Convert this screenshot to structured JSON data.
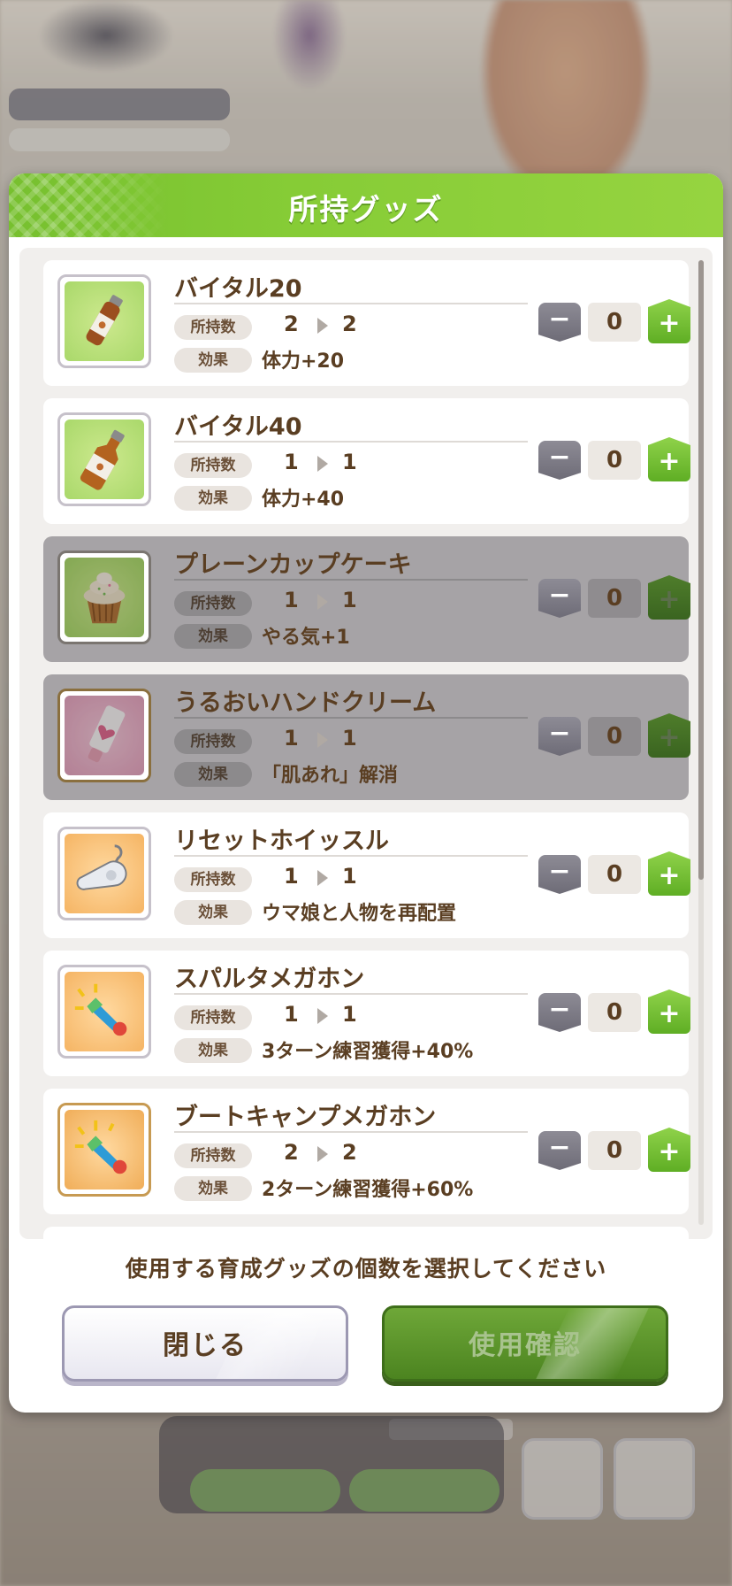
{
  "dialog": {
    "title": "所持グッズ",
    "instruction": "使用する育成グッズの個数を選択してください",
    "close_label": "閉じる",
    "confirm_label": "使用確認"
  },
  "labels": {
    "owned": "所持数",
    "effect": "効果"
  },
  "controls": {
    "minus": "−",
    "plus": "+"
  },
  "items": [
    {
      "name": "バイタル20",
      "owned_before": "2",
      "owned_after": "2",
      "effect": "体力+20",
      "count": "0",
      "enabled": true,
      "icon": "small-bottle-icon"
    },
    {
      "name": "バイタル40",
      "owned_before": "1",
      "owned_after": "1",
      "effect": "体力+40",
      "count": "0",
      "enabled": true,
      "icon": "bottle-icon"
    },
    {
      "name": "プレーンカップケーキ",
      "owned_before": "1",
      "owned_after": "1",
      "effect": "やる気+1",
      "count": "0",
      "enabled": false,
      "icon": "cupcake-icon"
    },
    {
      "name": "うるおいハンドクリーム",
      "owned_before": "1",
      "owned_after": "1",
      "effect": "「肌あれ」解消",
      "count": "0",
      "enabled": false,
      "icon": "hand-cream-icon"
    },
    {
      "name": "リセットホイッスル",
      "owned_before": "1",
      "owned_after": "1",
      "effect": "ウマ娘と人物を再配置",
      "count": "0",
      "enabled": true,
      "icon": "whistle-icon"
    },
    {
      "name": "スパルタメガホン",
      "owned_before": "1",
      "owned_after": "1",
      "effect": "3ターン練習獲得+40%",
      "count": "0",
      "enabled": true,
      "icon": "megaphone-icon"
    },
    {
      "name": "ブートキャンプメガホン",
      "owned_before": "2",
      "owned_after": "2",
      "effect": "2ターン練習獲得+60%",
      "count": "0",
      "enabled": true,
      "icon": "megaphone-gold-icon"
    }
  ]
}
